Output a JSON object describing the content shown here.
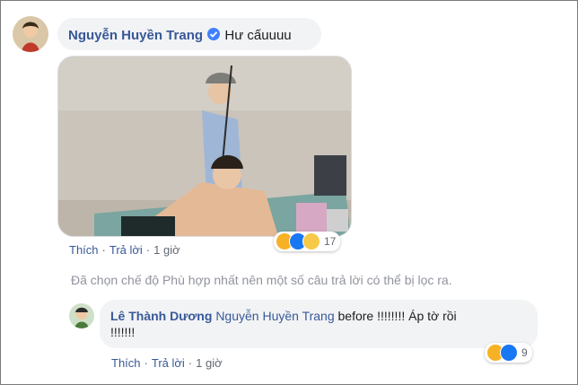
{
  "comment1": {
    "author": "Nguyễn Huyền Trang",
    "text": "Hư cấuuuu",
    "actions": {
      "like": "Thích",
      "reply": "Trả lời",
      "time": "1 giờ",
      "separator": "·"
    },
    "reactions": {
      "icons": [
        "haha-icon",
        "like-icon",
        "sad-icon"
      ],
      "count": "17"
    }
  },
  "filter_notice": "Đã chọn chế độ Phù hợp nhất nên một số câu trả lời có thể bị lọc ra.",
  "reply1": {
    "author": "Lê Thành Dương",
    "mention": "Nguyễn Huyền Trang",
    "text_line1": "before !!!!!!!! Áp tờ rồi",
    "text_line2": "!!!!!!!",
    "actions": {
      "like": "Thích",
      "reply": "Trả lời",
      "time": "1 giờ",
      "separator": "·"
    },
    "reactions": {
      "icons": [
        "haha-icon",
        "like-icon"
      ],
      "count": "9"
    }
  },
  "colors": {
    "link": "#385898",
    "bubble": "#f2f3f5",
    "muted": "#606770",
    "verified": "#4080ff"
  }
}
